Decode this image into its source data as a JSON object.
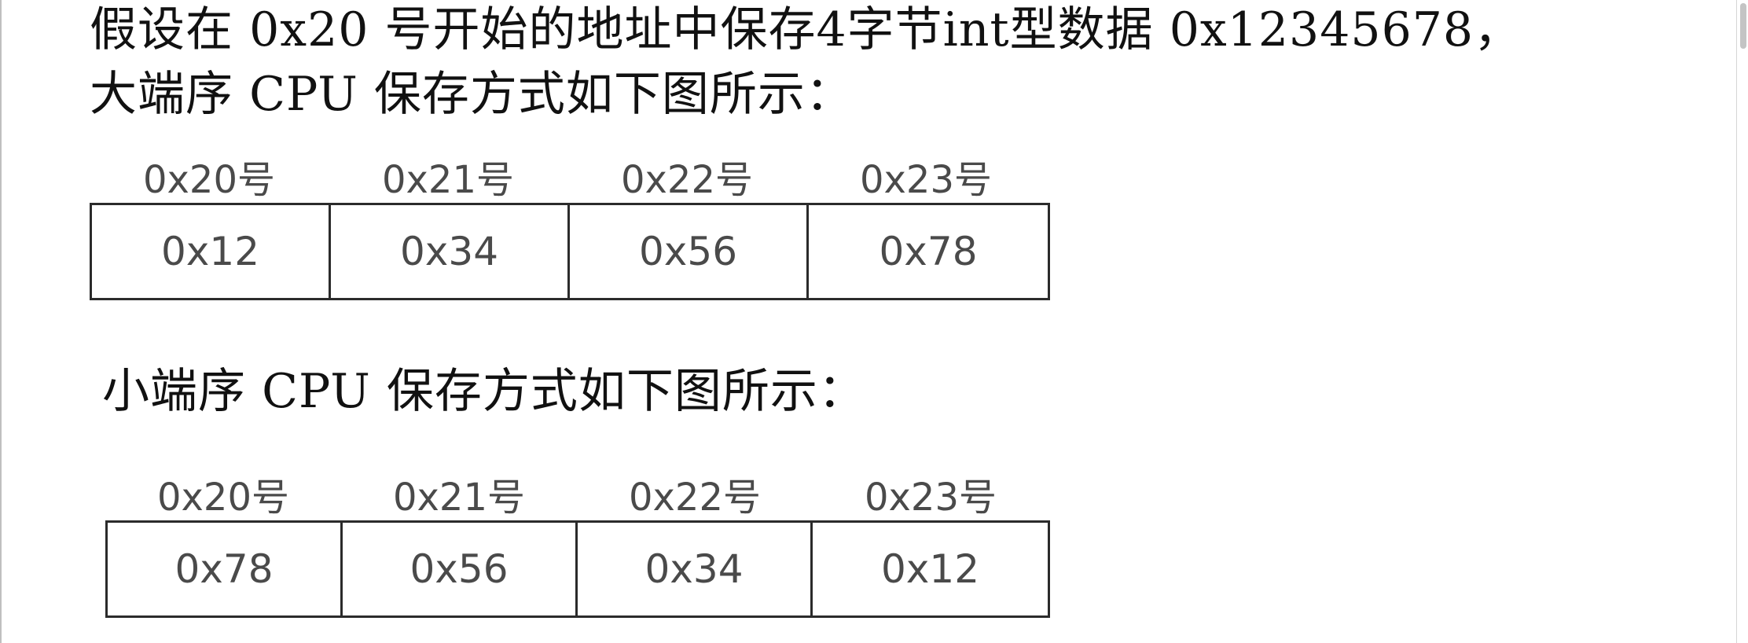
{
  "intro": {
    "line1": "假设在 0x20 号开始的地址中保存4字节int型数据 0x12345678，",
    "line2": "大端序 CPU 保存方式如下图所示："
  },
  "big_endian": {
    "addresses": [
      "0x20号",
      "0x21号",
      "0x22号",
      "0x23号"
    ],
    "values": [
      "0x12",
      "0x34",
      "0x56",
      "0x78"
    ]
  },
  "little_endian": {
    "caption": "小端序 CPU 保存方式如下图所示：",
    "addresses": [
      "0x20号",
      "0x21号",
      "0x22号",
      "0x23号"
    ],
    "values": [
      "0x78",
      "0x56",
      "0x34",
      "0x12"
    ]
  }
}
